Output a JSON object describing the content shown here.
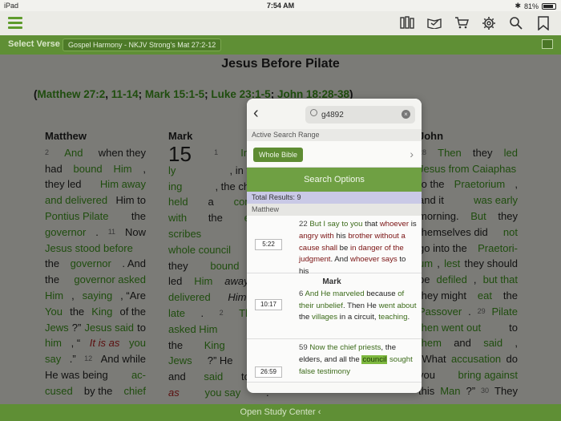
{
  "status": {
    "device": "iPad",
    "time": "7:54 AM",
    "battery": "81%"
  },
  "toolbar": {
    "icons": [
      "library-icon",
      "reading-plan-icon",
      "cart-icon",
      "gear-icon",
      "search-icon",
      "bookmark-icon"
    ]
  },
  "verse_bar": {
    "label": "Select Verse",
    "resource": "Gospel Harmony - NKJV Strong's Mat 27:2-12"
  },
  "page": {
    "title": "Jesus Before Pilate",
    "refs": [
      {
        "text": "(",
        "link": false
      },
      {
        "text": "Matthew 27:2",
        "link": true
      },
      {
        "text": ", ",
        "link": false
      },
      {
        "text": "11-14",
        "link": true
      },
      {
        "text": "; ",
        "link": false
      },
      {
        "text": "Mark 15:1-5",
        "link": true
      },
      {
        "text": "; ",
        "link": false
      },
      {
        "text": "Luke 23:1-5",
        "link": true
      },
      {
        "text": "; ",
        "link": false
      },
      {
        "text": "John 18:28-38",
        "link": true
      },
      {
        "text": ")",
        "link": false
      }
    ],
    "matthew": {
      "heading": "Matthew",
      "lines": [
        "<span class='n'>2</span> <span class='g'>And</span> when they",
        "had <span class='g'>bound</span> <span class='g'>Him</span>,",
        "they led <span class='g'>Him away</span>",
        "<span class='g'>and delivered</span> Him to",
        "<span class='g'>Pontius Pilate</span> the",
        "<span class='g'>governor</span>. <span class='n'>11</span> Now",
        "<span class='g'>Jesus stood before</span>",
        "the <span class='g'>governor</span>. And",
        "the <span class='g'>governor asked</span>",
        "<span class='g'>Him</span>, <span class='g'>saying</span>, “Are",
        "<span class='g'>You</span> the <span class='g'>King</span> of the",
        "<span class='g'>Jews</span>?” <span class='g'>Jesus said</span> to",
        "<span class='g'>him</span>, “<span class='r'>It is as</span> <span class='g'>you</span>",
        "<span class='g'>say</span>.” <span class='n'>12</span> And while",
        "He was being <span class='g'>ac-</span>",
        "<span class='g'>cused</span> by the <span class='g'>chief</span>"
      ]
    },
    "mark": {
      "heading": "Mark",
      "lines": [
        "<span class='big'>15</span> <span class='n'>1</span> <span class='g'>Immed</span>",
        "<span class='g'>ly</span>, in the m",
        "<span class='g'>ing</span>, the chief pr",
        "<span class='g'>held</span> a <span class='g'>consulta</span>",
        "<span class='g'>with</span> the <span class='g'>elders</span>",
        "<span class='g'>scribes</span> and",
        "<span class='g'>whole council</span>,",
        "they <span class='g'>bound</span> Je",
        "led <span class='g'>Him</span> <i>away</i>, a",
        "<span class='g'>delivered</span> <i>Him</i> to",
        "<span class='g'>late</span>. <span class='n'>2</span> <span class='g'>Then P</span>",
        "<span class='g'>asked Him</span>, “Are",
        "the <span class='g'>King</span> of the",
        "<span class='g'>Jews</span>?” He <span class='g'>answ</span>",
        "and <span class='g'>said</span> to him,",
        "<span class='r'>as</span> <span class='g'>you say</span>.”"
      ]
    },
    "john": {
      "heading": "John",
      "lines": [
        "<span class='n'>28</span> <span class='g'>Then</span> they <span class='g'>led</span>",
        "<span class='g'>Jesus from Caiaphas</span>",
        "to the <span class='g'>Praetorium</span>,",
        "and it <span class='g'>was early</span>",
        "morning. <span class='g'>But</span> they",
        "themselves did <span class='g'>not</span>",
        "go into the <span class='g'>Praetori-</span>",
        "<span class='g'>um</span>, <span class='g'>lest</span> they should",
        "be <span class='g'>defiled</span>, <span class='g'>but that</span>",
        "they might <span class='g'>eat</span> the",
        "<span class='g'>Passover</span>. <span class='n'>29</span> <span class='g'>Pilate</span>",
        "<span class='g'>then went out</span> to",
        "<span class='g'>them</span> and <span class='g'>said</span>,",
        "“What <span class='g'>accusation</span> do",
        "you <span class='g'>bring against</span>",
        "this <span class='g'>Man</span>?” <span class='n'>30</span> They"
      ]
    }
  },
  "bottom_bar": {
    "label": "Open Study Center"
  },
  "popover": {
    "search_value": "g4892",
    "range_label": "Active Search Range",
    "range_button": "Whole Bible",
    "search_options": "Search Options",
    "total": "Total Results: 9",
    "book": "Matthew",
    "results": [
      {
        "time": "5:22",
        "html": "<span class='num'>22</span> <span class='gr'>But I say</span> <span class='gr'>to you</span> that <span class='rd'>whoever</span> is <span class='rd'>angry</span> <span class='rd'>with</span> his <span class='rd'>brother</span> <span class='rd'>without a cause</span> <span class='rd'>shall</span> be <span class='rd'>in danger of the judgment</span>. And <span class='rd'>whoever says</span> to his"
      },
      {
        "time": "10:17",
        "heading": "Mark",
        "html": "<span class='num'>6</span> <span class='gr'>And He marveled</span> because <span class='gr'>of their unbelief</span>. Then He <span class='gr'>went about</span> the <span class='gr'>villages</span> in a circuit, <span class='gr'>teaching</span>."
      },
      {
        "time": "26:59",
        "html": "<span class='num'>59</span> <span class='gr'>Now the chief priests</span>, the elders, and all the <span class='hl'>council</span> <span class='gr'>sought false testimony</span>"
      }
    ]
  }
}
